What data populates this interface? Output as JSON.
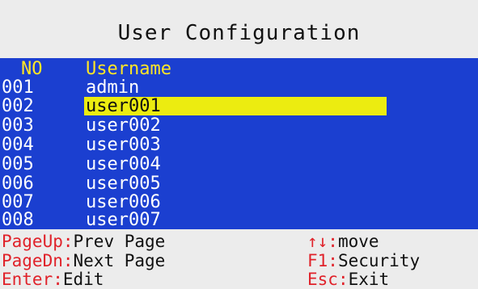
{
  "screen": {
    "title": "User Configuration"
  },
  "table": {
    "headers": {
      "no": "NO",
      "username": "Username"
    },
    "rows": [
      {
        "no": "001",
        "username": "admin"
      },
      {
        "no": "002",
        "username": "user001"
      },
      {
        "no": "003",
        "username": "user002"
      },
      {
        "no": "004",
        "username": "user003"
      },
      {
        "no": "005",
        "username": "user004"
      },
      {
        "no": "006",
        "username": "user005"
      },
      {
        "no": "007",
        "username": "user006"
      },
      {
        "no": "008",
        "username": "user007"
      }
    ],
    "selected_row": "002"
  },
  "footer": {
    "page_up": {
      "key": "PageUp",
      "sep": ":",
      "action": "Prev Page"
    },
    "page_dn": {
      "key": "PageDn",
      "sep": ":",
      "action": "Next Page"
    },
    "enter": {
      "key": "Enter",
      "sep": ":",
      "action": "Edit"
    },
    "move": {
      "key": "↑↓",
      "sep": ":",
      "action": "move"
    },
    "f1": {
      "key": "F1",
      "sep": ":",
      "action": "Security"
    },
    "esc": {
      "key": "Esc",
      "sep": ":",
      "action": "Exit"
    }
  },
  "colors": {
    "background": "#ececec",
    "table_background": "#1b3fd0",
    "header_text": "#ffe626",
    "row_text": "#ffffff",
    "selection_highlight": "#ecec10",
    "key_text": "#e0222a",
    "action_text": "#111111"
  }
}
